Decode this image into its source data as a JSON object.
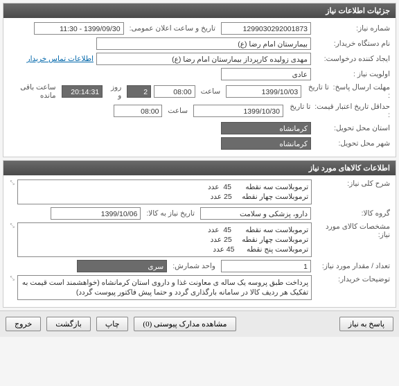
{
  "panel1": {
    "title": "جزئیات اطلاعات نیاز",
    "rows": {
      "need_no_label": "شماره نیاز:",
      "need_no": "1299030292001873",
      "public_date_label": "تاریخ و ساعت اعلان عمومی:",
      "public_date": "1399/09/30 - 11:30",
      "buyer_label": "نام دستگاه خریدار:",
      "buyer": "بیمارستان امام رضا (ع)",
      "requester_label": "ایجاد کننده درخواست:",
      "requester": "مهدی زولیده کارپرداز بیمارستان امام رضا (ع)",
      "contact_link": "اطلاعات تماس خریدار",
      "priority_label": "اولویت نیاز :",
      "priority": "عادی",
      "deadline_label": "مهلت ارسال پاسخ:",
      "to_date_label": "تا تاریخ :",
      "deadline_date": "1399/10/03",
      "time_label": "ساعت",
      "deadline_time": "08:00",
      "days": "2",
      "days_label": "روز و",
      "countdown": "20:14:31",
      "countdown_label": "ساعت باقی مانده",
      "min_valid_label": "حداقل تاریخ اعتبار قیمت:",
      "min_valid_to_label": "تا تاریخ :",
      "min_valid_date": "1399/10/30",
      "min_valid_time": "08:00",
      "province_label": "استان محل تحویل:",
      "province": "کرمانشاه",
      "city_label": "شهر محل تحویل:",
      "city": "کرمانشاه"
    }
  },
  "panel2": {
    "title": "اطلاعات کالاهای مورد نیاز",
    "rows": {
      "desc_label": "شرح کلی نیاز:",
      "desc": "ترموبلاست سه نقطه       45  عدد\nترموبلاست چهار نقطه     25 عدد",
      "group_label": "گروه کالا:",
      "group": "دارو، پزشکی و سلامت",
      "delivery_date_label": "تاریخ نیاز به کالا:",
      "delivery_date": "1399/10/06",
      "spec_label": "مشخصات کالای مورد نیاز:",
      "spec": "ترموبلاست سه نقطه       45  عدد\nترموبلاست چهار نقطه     25 عدد\nترموبلاست پنج نقطه      45 عدد",
      "qty_label": "تعداد / مقدار مورد نیاز:",
      "qty": "1",
      "unit_label": "واحد شمارش:",
      "unit": "سری",
      "notes_label": "توضیحات خریدار:",
      "notes": "پرداخت طبق پروسه یک ساله ی معاونت غذا و داروی استان کرمانشاه (خواهشمند است قیمت به تفکیک هر ردیف کالا در سامانه بارگذاری گردد و حتما پیش فاکتور پیوست گردد)"
    }
  },
  "footer": {
    "respond": "پاسخ به نیاز",
    "attachments": "مشاهده مدارک پیوستی (0)",
    "print": "چاپ",
    "back": "بازگشت",
    "exit": "خروج"
  }
}
